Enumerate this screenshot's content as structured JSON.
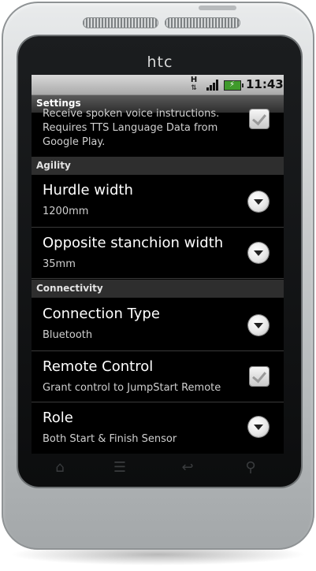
{
  "device": {
    "brand_logo": "htc"
  },
  "status_bar": {
    "network_type": "H",
    "network_arrows": "⇅",
    "time": "11:43"
  },
  "title_bar": {
    "title": "Settings"
  },
  "partial_item": {
    "summary_line1": "Receive spoken voice instructions.",
    "summary_line2": "Requires TTS Language Data from",
    "summary_line3": "Google Play.",
    "checked": true
  },
  "sections": {
    "agility": {
      "header": "Agility",
      "items": [
        {
          "title": "Hurdle width",
          "summary": "1200mm",
          "control": "dropdown"
        },
        {
          "title": "Opposite stanchion width",
          "summary": "35mm",
          "control": "dropdown"
        }
      ]
    },
    "connectivity": {
      "header": "Connectivity",
      "items": [
        {
          "title": "Connection Type",
          "summary": "Bluetooth",
          "control": "dropdown"
        },
        {
          "title": "Remote Control",
          "summary": "Grant control to JumpStart Remote",
          "control": "checkbox",
          "checked": true
        },
        {
          "title": "Role",
          "summary": "Both Start & Finish Sensor",
          "control": "dropdown"
        }
      ]
    }
  },
  "nav_icons": [
    "home-icon",
    "menu-icon",
    "back-icon",
    "search-icon"
  ],
  "colors": {
    "screen_bg": "#000000",
    "header_bg": "#2e2e2e",
    "title_text": "#ffffff",
    "summary_text": "#cfcfcf",
    "battery": "#3f9a2b"
  }
}
